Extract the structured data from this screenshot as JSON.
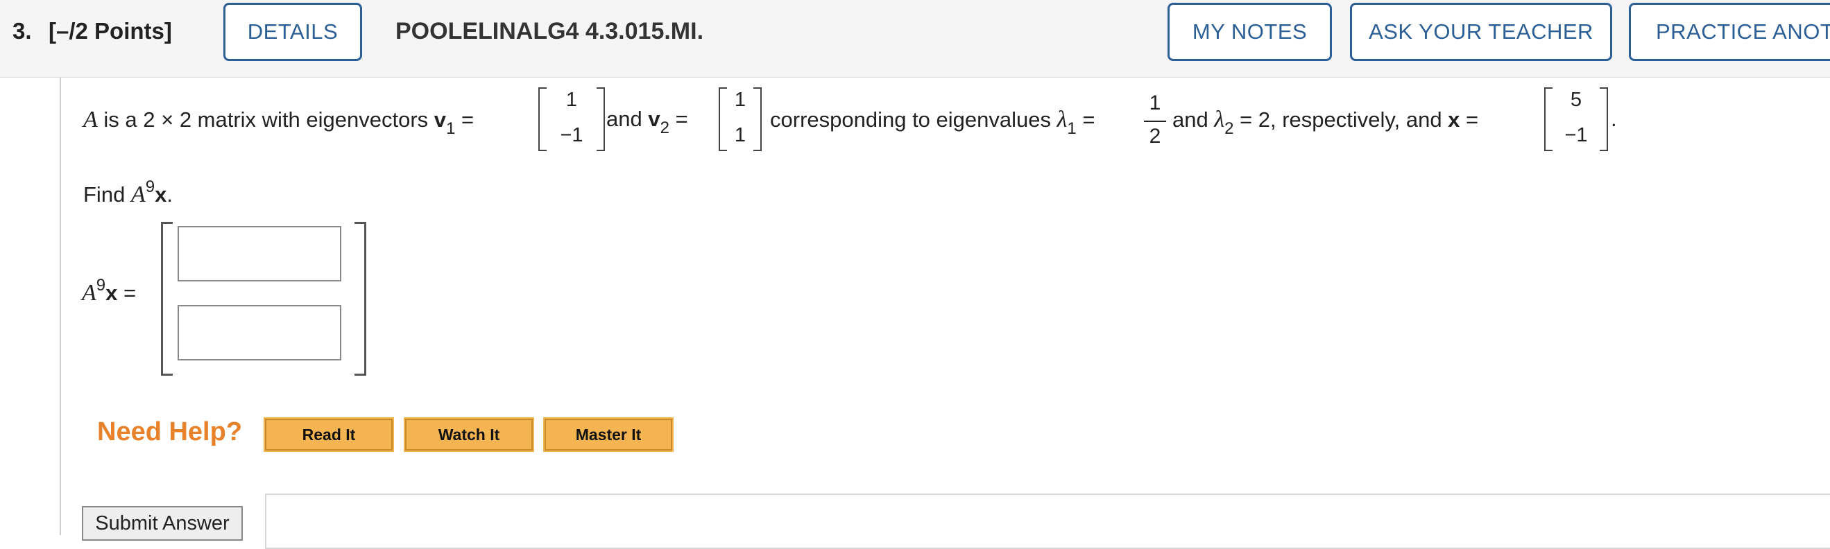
{
  "header": {
    "number": "3.",
    "points": "[–/2 Points]",
    "details_label": "DETAILS",
    "problem_id": "POOLELINALG4 4.3.015.MI.",
    "my_notes_label": "MY NOTES",
    "ask_teacher_label": "ASK YOUR TEACHER",
    "practice_label": "PRACTICE ANOTHER"
  },
  "question": {
    "t1_A": "A",
    "t1": " is a 2 × 2 matrix with eigenvectors ",
    "v": "v",
    "sub1": "1",
    "sub2": "2",
    "eq": " = ",
    "v1": [
      "1",
      "−1"
    ],
    "and": " and ",
    "v2": [
      "1",
      "1"
    ],
    "t2": " corresponding to eigenvalues ",
    "lambda": "λ",
    "frac_num": "1",
    "frac_den": "2",
    "t3": " = 2, respectively, and ",
    "x": "x",
    "xvec": [
      "5",
      "−1"
    ],
    "period": "."
  },
  "find": {
    "prefix": "Find ",
    "A": "A",
    "exp": "9",
    "x": "x",
    "suffix": "."
  },
  "answer": {
    "eq": " =",
    "input1": "",
    "input2": ""
  },
  "help": {
    "label": "Need Help?",
    "read": "Read It",
    "watch": "Watch It",
    "master": "Master It"
  },
  "submit": "Submit Answer",
  "colors": {
    "header_button_border": "#2b5f96",
    "help_label": "#e8822a",
    "help_button_bg": "#f4b452"
  }
}
